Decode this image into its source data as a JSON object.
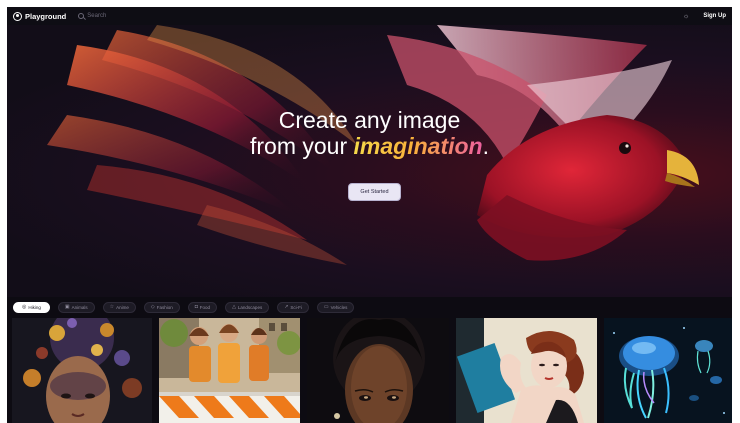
{
  "nav": {
    "logo_text": "Playground",
    "search_placeholder": "Search",
    "sun_icon": "sun-icon",
    "signup_label": "Sign Up"
  },
  "hero": {
    "line1": "Create any image",
    "line2_prefix": "from your ",
    "line2_accent": "imagination",
    "line2_suffix": ".",
    "cta_label": "Get Started",
    "accent_colors": [
      "#f6d94a",
      "#f9b13b",
      "#ee5fa0"
    ],
    "bird_color": "#c3172e"
  },
  "filters": [
    {
      "label": "Hiking",
      "icon": "compass-icon",
      "active": true
    },
    {
      "label": "Animals",
      "icon": "paw-icon",
      "active": false
    },
    {
      "label": "Anime",
      "icon": "star-icon",
      "active": false
    },
    {
      "label": "Fashion",
      "icon": "shirt-icon",
      "active": false
    },
    {
      "label": "Food",
      "icon": "cup-icon",
      "active": false
    },
    {
      "label": "Landscapes",
      "icon": "mountain-icon",
      "active": false
    },
    {
      "label": "Sci-Fi",
      "icon": "rocket-icon",
      "active": false
    },
    {
      "label": "Vehicles",
      "icon": "car-icon",
      "active": false
    }
  ],
  "gallery": [
    {
      "subject": "ornate-portrait"
    },
    {
      "subject": "marathon-runners"
    },
    {
      "subject": "woman-portrait"
    },
    {
      "subject": "art-deco-woman"
    },
    {
      "subject": "neon-jellyfish"
    }
  ]
}
